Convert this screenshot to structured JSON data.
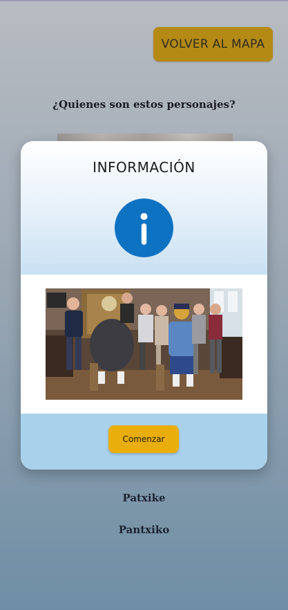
{
  "header": {
    "back_button_label": "VOLVER AL MAPA"
  },
  "main": {
    "question": "¿Quienes son estos personajes?",
    "names": [
      "Patxike",
      "Pantxiko"
    ]
  },
  "modal": {
    "title": "INFORMACIÓN",
    "icon": "info-icon",
    "photo_icon": "group-photo",
    "start_button_label": "Comenzar"
  },
  "colors": {
    "back_button": "#b48a14",
    "info_circle": "#0d72c2",
    "start_button": "#e9ae0c",
    "modal_footer": "#a9d1ec"
  }
}
